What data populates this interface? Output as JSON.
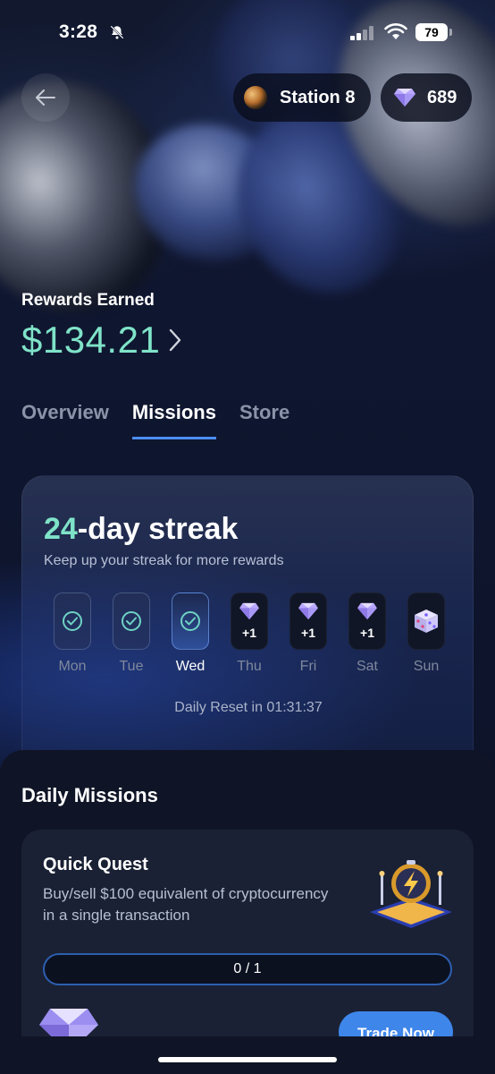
{
  "status_bar": {
    "time": "3:28",
    "battery": "79"
  },
  "header": {
    "station": {
      "label": "Station 8",
      "icon": "planet-icon"
    },
    "gems": {
      "count": "689",
      "icon": "diamond-icon"
    }
  },
  "rewards": {
    "label": "Rewards Earned",
    "amount": "$134.21"
  },
  "tabs": [
    {
      "label": "Overview",
      "active": false
    },
    {
      "label": "Missions",
      "active": true
    },
    {
      "label": "Store",
      "active": false
    }
  ],
  "streak": {
    "count": "24",
    "title_suffix": "-day streak",
    "subtitle": "Keep up your streak for more rewards",
    "days": [
      {
        "label": "Mon",
        "state": "done"
      },
      {
        "label": "Tue",
        "state": "done"
      },
      {
        "label": "Wed",
        "state": "today"
      },
      {
        "label": "Thu",
        "state": "future",
        "reward": "+1"
      },
      {
        "label": "Fri",
        "state": "future",
        "reward": "+1"
      },
      {
        "label": "Sat",
        "state": "future",
        "reward": "+1"
      },
      {
        "label": "Sun",
        "state": "future",
        "icon": "dice-icon"
      }
    ],
    "reset_text": "Daily Reset in 01:31:37"
  },
  "daily_missions": {
    "title": "Daily Missions",
    "missions": [
      {
        "title": "Quick Quest",
        "description": "Buy/sell $100 equivalent of cryptocurrency in a single transaction",
        "progress_text": "0 / 1",
        "progress": 0,
        "button_label": "Trade Now"
      }
    ]
  },
  "colors": {
    "accent": "#3e86ea",
    "highlight": "#7fe3c8"
  }
}
